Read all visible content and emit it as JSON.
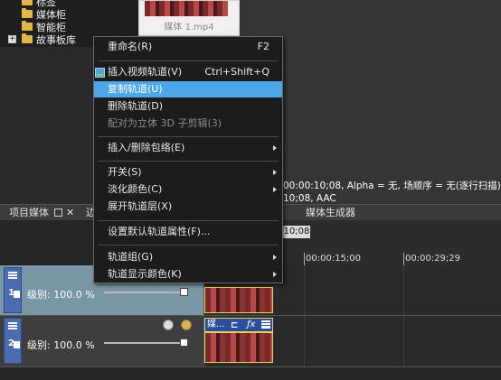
{
  "explorer": {
    "items": [
      {
        "label": "标签",
        "expandable": false
      },
      {
        "label": "媒体柜",
        "expandable": false
      },
      {
        "label": "智能柜",
        "expandable": false
      },
      {
        "label": "故事板库",
        "expandable": true
      }
    ],
    "expander_symbol": "+"
  },
  "media_thumbnail": {
    "caption": "媒体 1.mp4"
  },
  "properties_text": {
    "line1": "00:00:10;08, Alpha = 无, 场顺序 = 无(逐行扫描), A",
    "line2": "10;08, AAC"
  },
  "tabs": {
    "project_media": "项目媒体",
    "partial": "边",
    "media_generator": "媒体生成器"
  },
  "ruler": {
    "current_time": "10;08",
    "marks": [
      "00:00:15;00",
      "00:00:29;29"
    ]
  },
  "tracks": [
    {
      "number": "1",
      "level_label": "级别: 100.0 %",
      "level_value": 1.0
    },
    {
      "number": "2",
      "level_label": "级别: 100.0 %",
      "level_value": 1.0
    }
  ],
  "clip2_label": "媒...",
  "clip2_icons": [
    "crop-icon",
    "fx-icon",
    "menu-icon"
  ],
  "context_menu": {
    "items": [
      {
        "label": "重命名(R)",
        "shortcut": "F2"
      },
      {
        "label": "插入视频轨道(V)",
        "shortcut": "Ctrl+Shift+Q"
      },
      {
        "label": "复制轨道(U)",
        "highlighted": true
      },
      {
        "label": "删除轨道(D)"
      },
      {
        "label": "配对为立体 3D 子剪辑(3)",
        "disabled": true
      },
      {
        "label": "插入/删除包络(E)",
        "submenu": true
      },
      {
        "label": "开关(S)",
        "submenu": true
      },
      {
        "label": "淡化颜色(C)",
        "submenu": true
      },
      {
        "label": "展开轨道层(X)"
      },
      {
        "label": "设置默认轨道属性(F)..."
      },
      {
        "label": "轨道组(G)",
        "submenu": true
      },
      {
        "label": "轨道显示颜色(K)",
        "submenu": true
      }
    ]
  },
  "colors": {
    "highlight": "#4ea6e8",
    "track1_bg": "#7896a5",
    "track_handle": "#4b6cb0",
    "clip_border": "#e6d15a",
    "folder": "#e2b84c"
  }
}
